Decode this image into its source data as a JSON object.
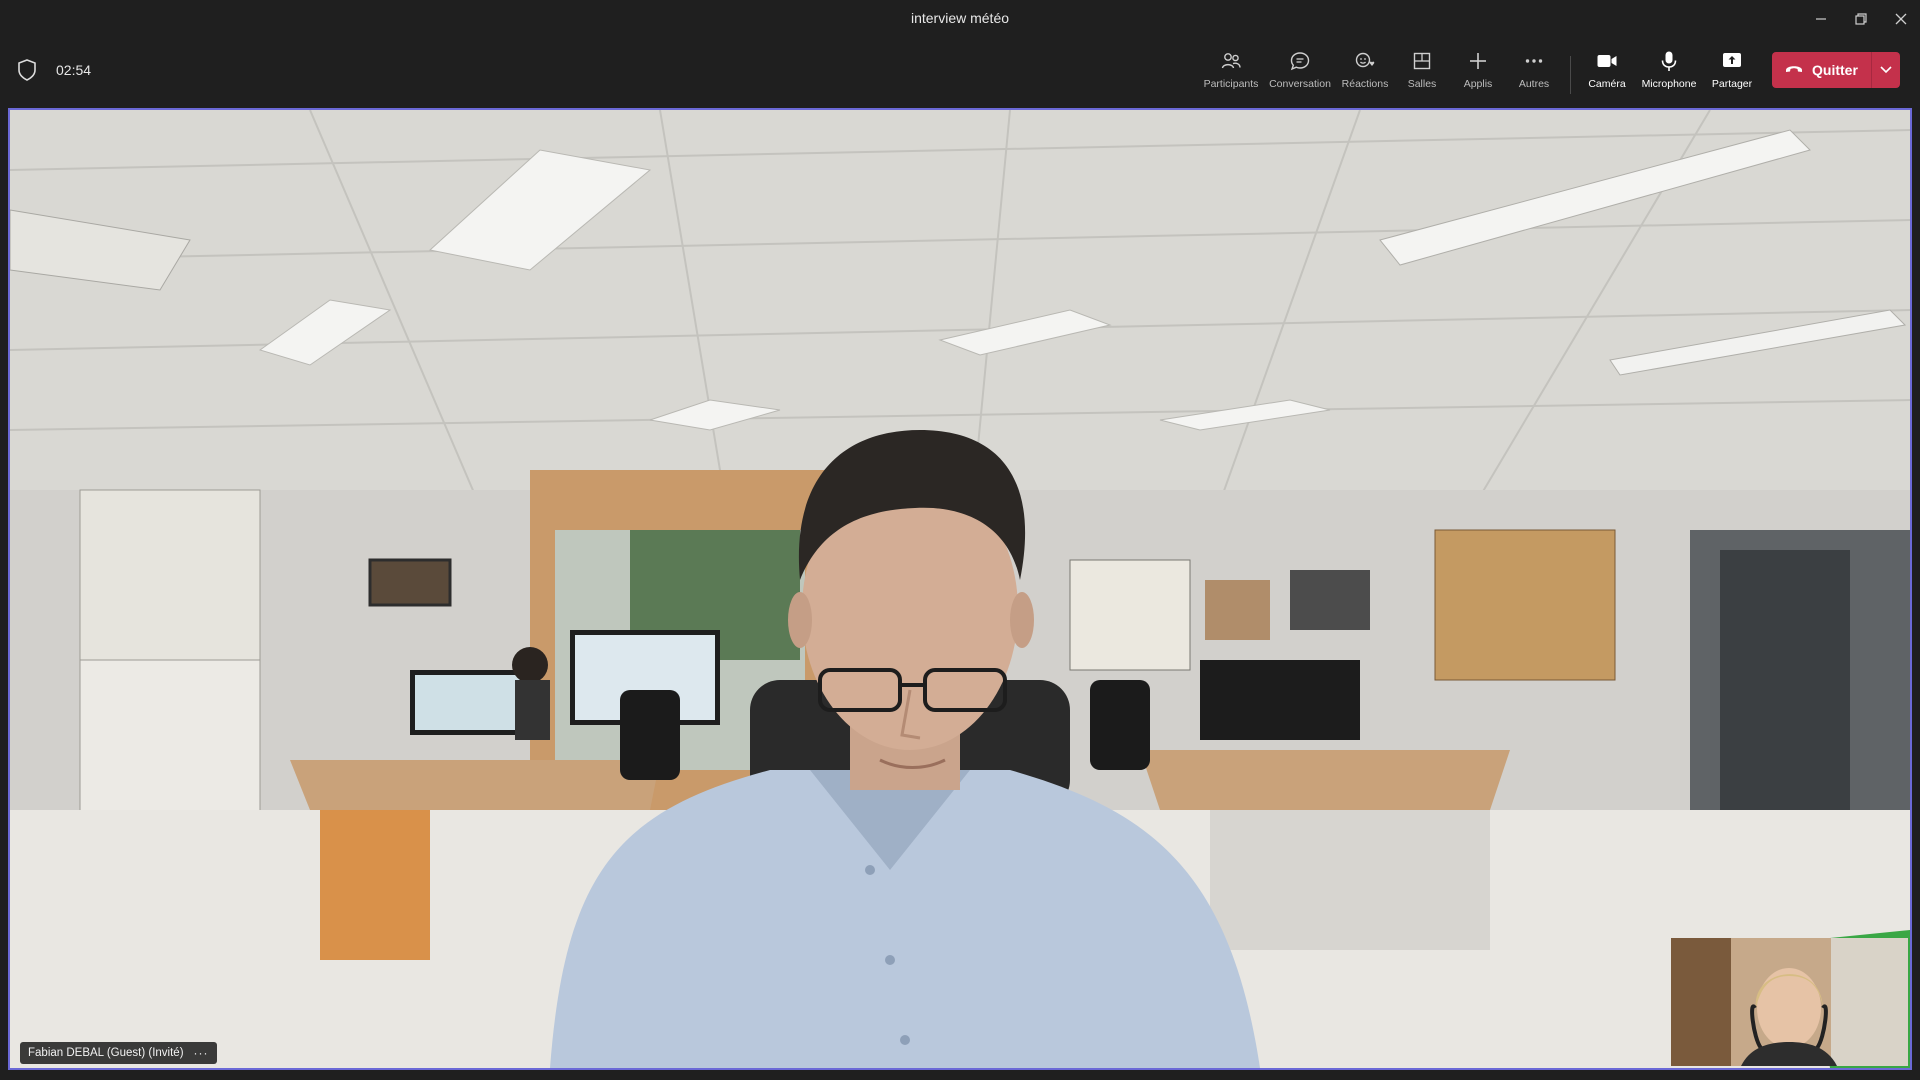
{
  "window": {
    "title": "interview météo"
  },
  "meeting": {
    "elapsed_time": "02:54"
  },
  "toolbar": {
    "participants_label": "Participants",
    "chat_label": "Conversation",
    "reactions_label": "Réactions",
    "rooms_label": "Salles",
    "apps_label": "Applis",
    "more_label": "Autres",
    "camera_label": "Caméra",
    "microphone_label": "Microphone",
    "share_label": "Partager",
    "leave_label": "Quitter"
  },
  "main_video": {
    "participant_name": "Fabian DEBAL (Guest) (Invité)",
    "more_glyph": "···"
  },
  "icons": {
    "shield": "shield-icon",
    "participants": "people-icon",
    "chat": "chat-bubble-icon",
    "reactions": "emoji-icon",
    "rooms": "breakout-rooms-icon",
    "apps": "plus-icon",
    "more": "ellipsis-icon",
    "camera": "video-camera-icon",
    "microphone": "microphone-icon",
    "share": "share-screen-icon",
    "leave": "phone-hangup-icon"
  },
  "colors": {
    "leave_button": "#c4314b",
    "active_speaker_border": "#6b69d6",
    "background": "#1f1f1f"
  }
}
